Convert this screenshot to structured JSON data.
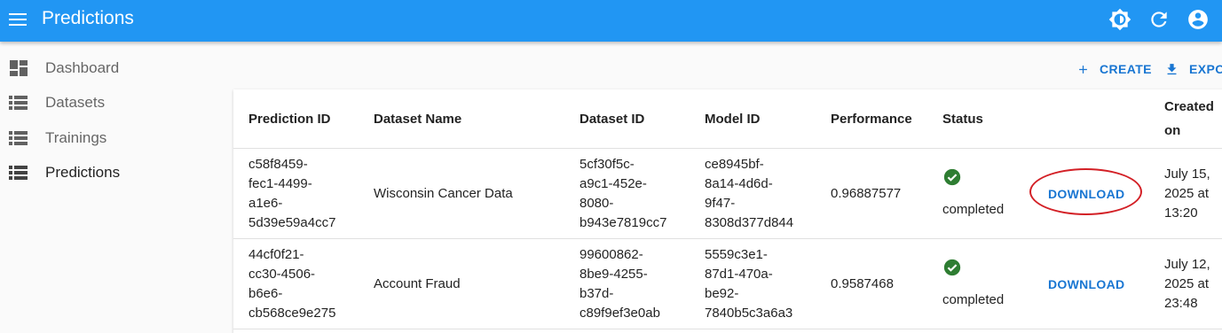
{
  "header": {
    "title": "Predictions"
  },
  "toolbar": {
    "icons": [
      "brightness-icon",
      "refresh-icon",
      "account-icon"
    ]
  },
  "sidebar": {
    "items": [
      {
        "label": "Dashboard",
        "icon": "dashboard-icon"
      },
      {
        "label": "Datasets",
        "icon": "list-icon"
      },
      {
        "label": "Trainings",
        "icon": "list-icon"
      },
      {
        "label": "Predictions",
        "icon": "list-icon",
        "active": true
      }
    ]
  },
  "actions": {
    "create": "CREATE",
    "export": "EXPO"
  },
  "table": {
    "headers": {
      "prediction_id": "Prediction ID",
      "dataset_name": "Dataset Name",
      "dataset_id": "Dataset ID",
      "model_id": "Model ID",
      "performance": "Performance",
      "status": "Status",
      "created_line1": "Created",
      "created_line2": "on"
    },
    "rows": [
      {
        "prediction_id": [
          "c58f8459-",
          "fec1-4499-",
          "a1e6-",
          "5d39e59a4cc7"
        ],
        "dataset_name": "Wisconsin Cancer Data",
        "dataset_id": [
          "5cf30f5c-",
          "a9c1-452e-",
          "8080-",
          "b943e7819cc7"
        ],
        "model_id": [
          "ce8945bf-",
          "8a14-4d6d-",
          "9f47-",
          "8308d377d844"
        ],
        "performance": "0.96887577",
        "status": "completed",
        "download": "DOWNLOAD",
        "created": [
          "July 15,",
          "2025 at",
          "13:20"
        ]
      },
      {
        "prediction_id": [
          "44cf0f21-",
          "cc30-4506-",
          "b6e6-",
          "cb568ce9e275"
        ],
        "dataset_name": "Account Fraud",
        "dataset_id": [
          "99600862-",
          "8be9-4255-",
          "b37d-",
          "c89f9ef3e0ab"
        ],
        "model_id": [
          "5559c3e1-",
          "87d1-470a-",
          "be92-",
          "7840b5c3a6a3"
        ],
        "performance": "0.9587468",
        "status": "completed",
        "download": "DOWNLOAD",
        "created": [
          "July 12,",
          "2025 at",
          "23:48"
        ]
      }
    ]
  },
  "colors": {
    "appbar": "#2196f3",
    "accent": "#1976d2",
    "success": "#2e7d32",
    "annotation": "#d32026"
  }
}
